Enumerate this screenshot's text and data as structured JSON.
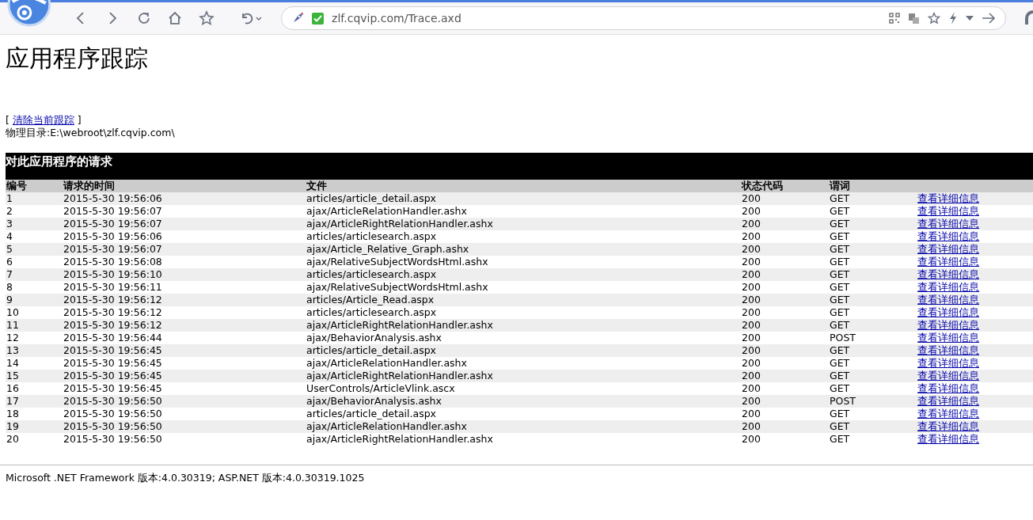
{
  "browser": {
    "url": "zlf.cqvip.com/Trace.axd"
  },
  "title": "应用程序跟踪",
  "clear_link": "清除当前跟踪",
  "clear_brackets": [
    "[",
    "]"
  ],
  "physical_dir": "物理目录:E:\\webroot\\zlf.cqvip.com\\",
  "section_title": "对此应用程序的请求",
  "columns": [
    "编号",
    "请求的时间",
    "文件",
    "状态代码",
    "谓词"
  ],
  "rows": [
    {
      "no": "1",
      "time": "2015-5-30 19:56:06",
      "file": "articles/article_detail.aspx",
      "status": "200",
      "verb": "GET",
      "link": "查看详细信息"
    },
    {
      "no": "2",
      "time": "2015-5-30 19:56:07",
      "file": "ajax/ArticleRelationHandler.ashx",
      "status": "200",
      "verb": "GET",
      "link": "查看详细信息"
    },
    {
      "no": "3",
      "time": "2015-5-30 19:56:07",
      "file": "ajax/ArticleRightRelationHandler.ashx",
      "status": "200",
      "verb": "GET",
      "link": "查看详细信息"
    },
    {
      "no": "4",
      "time": "2015-5-30 19:56:06",
      "file": "articles/articlesearch.aspx",
      "status": "200",
      "verb": "GET",
      "link": "查看详细信息"
    },
    {
      "no": "5",
      "time": "2015-5-30 19:56:07",
      "file": "ajax/Article_Relative_Graph.ashx",
      "status": "200",
      "verb": "GET",
      "link": "查看详细信息"
    },
    {
      "no": "6",
      "time": "2015-5-30 19:56:08",
      "file": "ajax/RelativeSubjectWordsHtml.ashx",
      "status": "200",
      "verb": "GET",
      "link": "查看详细信息"
    },
    {
      "no": "7",
      "time": "2015-5-30 19:56:10",
      "file": "articles/articlesearch.aspx",
      "status": "200",
      "verb": "GET",
      "link": "查看详细信息"
    },
    {
      "no": "8",
      "time": "2015-5-30 19:56:11",
      "file": "ajax/RelativeSubjectWordsHtml.ashx",
      "status": "200",
      "verb": "GET",
      "link": "查看详细信息"
    },
    {
      "no": "9",
      "time": "2015-5-30 19:56:12",
      "file": "articles/Article_Read.aspx",
      "status": "200",
      "verb": "GET",
      "link": "查看详细信息"
    },
    {
      "no": "10",
      "time": "2015-5-30 19:56:12",
      "file": "articles/articlesearch.aspx",
      "status": "200",
      "verb": "GET",
      "link": "查看详细信息"
    },
    {
      "no": "11",
      "time": "2015-5-30 19:56:12",
      "file": "ajax/ArticleRightRelationHandler.ashx",
      "status": "200",
      "verb": "GET",
      "link": "查看详细信息"
    },
    {
      "no": "12",
      "time": "2015-5-30 19:56:44",
      "file": "ajax/BehaviorAnalysis.ashx",
      "status": "200",
      "verb": "POST",
      "link": "查看详细信息"
    },
    {
      "no": "13",
      "time": "2015-5-30 19:56:45",
      "file": "articles/article_detail.aspx",
      "status": "200",
      "verb": "GET",
      "link": "查看详细信息"
    },
    {
      "no": "14",
      "time": "2015-5-30 19:56:45",
      "file": "ajax/ArticleRelationHandler.ashx",
      "status": "200",
      "verb": "GET",
      "link": "查看详细信息"
    },
    {
      "no": "15",
      "time": "2015-5-30 19:56:45",
      "file": "ajax/ArticleRightRelationHandler.ashx",
      "status": "200",
      "verb": "GET",
      "link": "查看详细信息"
    },
    {
      "no": "16",
      "time": "2015-5-30 19:56:45",
      "file": "UserControls/ArticleVlink.ascx",
      "status": "200",
      "verb": "GET",
      "link": "查看详细信息"
    },
    {
      "no": "17",
      "time": "2015-5-30 19:56:50",
      "file": "ajax/BehaviorAnalysis.ashx",
      "status": "200",
      "verb": "POST",
      "link": "查看详细信息"
    },
    {
      "no": "18",
      "time": "2015-5-30 19:56:50",
      "file": "articles/article_detail.aspx",
      "status": "200",
      "verb": "GET",
      "link": "查看详细信息"
    },
    {
      "no": "19",
      "time": "2015-5-30 19:56:50",
      "file": "ajax/ArticleRelationHandler.ashx",
      "status": "200",
      "verb": "GET",
      "link": "查看详细信息"
    },
    {
      "no": "20",
      "time": "2015-5-30 19:56:50",
      "file": "ajax/ArticleRightRelationHandler.ashx",
      "status": "200",
      "verb": "GET",
      "link": "查看详细信息"
    }
  ],
  "footer": "Microsoft .NET Framework 版本:4.0.30319; ASP.NET 版本:4.0.30319.1025"
}
